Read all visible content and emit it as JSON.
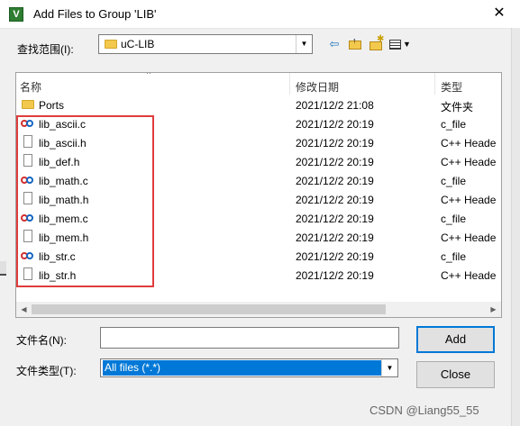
{
  "window": {
    "title": "Add Files to Group 'LIB'"
  },
  "toolbar": {
    "lookin_label": "查找范围(I):",
    "lookin_value": "uC-LIB"
  },
  "list": {
    "headers": {
      "name": "名称",
      "date": "修改日期",
      "type": "类型"
    },
    "rows": [
      {
        "name": "Ports",
        "date": "2021/12/2 21:08",
        "type": "文件夹",
        "icon": "folder-icon"
      },
      {
        "name": "lib_ascii.c",
        "date": "2021/12/2 20:19",
        "type": "c_file",
        "icon": "c-file-icon"
      },
      {
        "name": "lib_ascii.h",
        "date": "2021/12/2 20:19",
        "type": "C++ Heade",
        "icon": "header-file-icon"
      },
      {
        "name": "lib_def.h",
        "date": "2021/12/2 20:19",
        "type": "C++ Heade",
        "icon": "header-file-icon"
      },
      {
        "name": "lib_math.c",
        "date": "2021/12/2 20:19",
        "type": "c_file",
        "icon": "c-file-icon"
      },
      {
        "name": "lib_math.h",
        "date": "2021/12/2 20:19",
        "type": "C++ Heade",
        "icon": "header-file-icon"
      },
      {
        "name": "lib_mem.c",
        "date": "2021/12/2 20:19",
        "type": "c_file",
        "icon": "c-file-icon"
      },
      {
        "name": "lib_mem.h",
        "date": "2021/12/2 20:19",
        "type": "C++ Heade",
        "icon": "header-file-icon"
      },
      {
        "name": "lib_str.c",
        "date": "2021/12/2 20:19",
        "type": "c_file",
        "icon": "c-file-icon"
      },
      {
        "name": "lib_str.h",
        "date": "2021/12/2 20:19",
        "type": "C++ Heade",
        "icon": "header-file-icon"
      }
    ]
  },
  "form": {
    "filename_label": "文件名(N):",
    "filename_value": "",
    "filetype_label": "文件类型(T):",
    "filetype_value": "All files (*.*)"
  },
  "buttons": {
    "add": "Add",
    "close": "Close"
  },
  "watermark": "CSDN @Liang55_55",
  "colors": {
    "highlight": "#e03c3c",
    "selection": "#0078d7",
    "folder": "#f2c94c"
  }
}
